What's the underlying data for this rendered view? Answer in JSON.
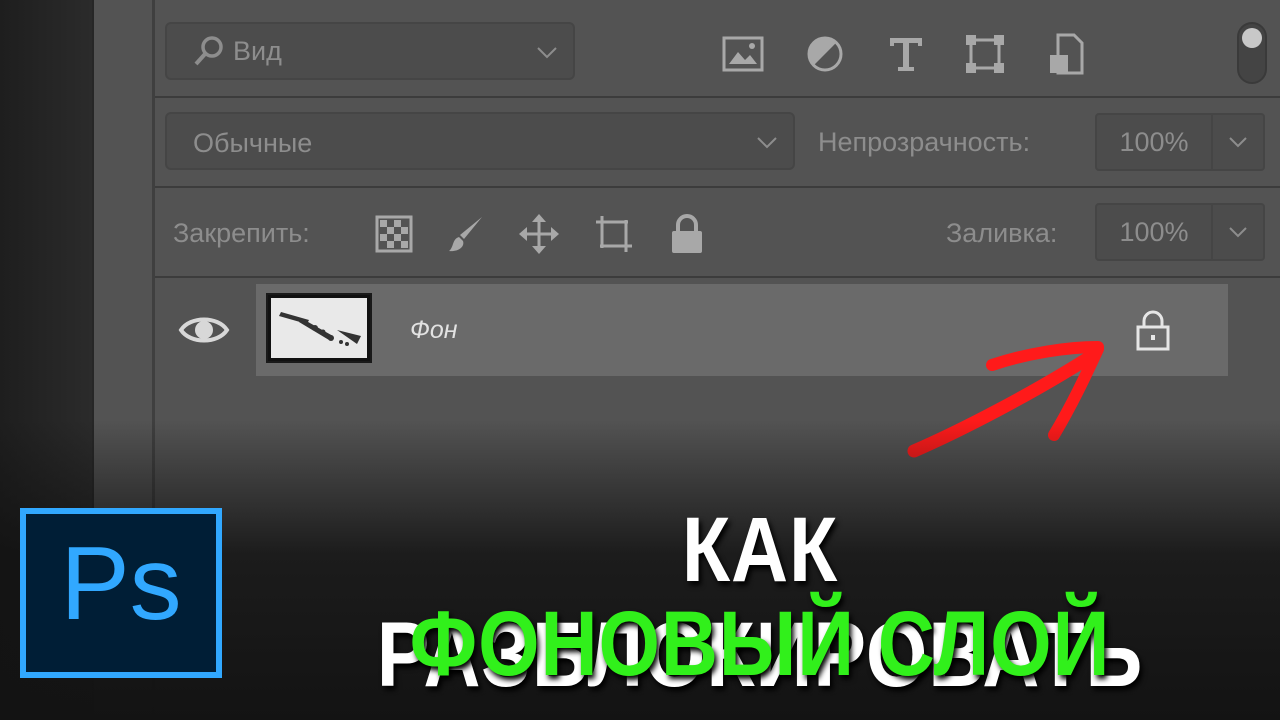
{
  "filter": {
    "icon": "search-icon",
    "label": "Вид",
    "filter_icons": [
      "image-filter-icon",
      "adjustment-filter-icon",
      "text-filter-icon",
      "shape-filter-icon",
      "smart-object-filter-icon"
    ],
    "toggle_icon": "filter-toggle"
  },
  "blend": {
    "mode": "Обычные",
    "opacity_label": "Непрозрачность:",
    "opacity_value": "100%"
  },
  "lock": {
    "label": "Закрепить:",
    "icons": [
      "lock-transparent-pixels-icon",
      "lock-image-pixels-icon",
      "lock-position-icon",
      "lock-artboard-icon",
      "lock-all-icon"
    ],
    "fill_label": "Заливка:",
    "fill_value": "100%"
  },
  "layer": {
    "name": "Фон",
    "visibility_icon": "eye-icon",
    "locked_icon": "lock-icon"
  },
  "overlay": {
    "logo_text": "Ps",
    "title_line1": "КАК РАЗБЛОКИРОВАТЬ",
    "title_line2": "ФОНОВЫЙ СЛОЙ",
    "accent_color": "#31f01b",
    "logo_color": "#31a8ff",
    "arrow_color": "#ff1a1a"
  }
}
